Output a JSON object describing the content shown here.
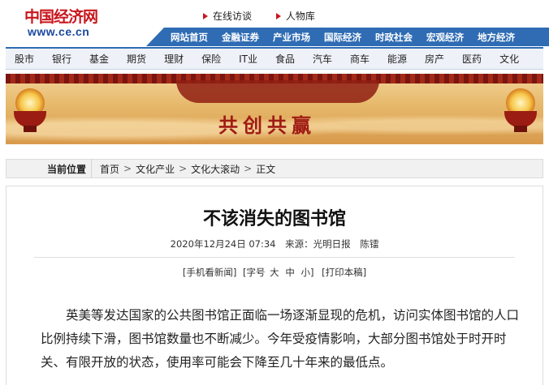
{
  "header": {
    "logo_text": "中国经济网",
    "logo_url": "www.ce.cn",
    "top_links": [
      "在线访谈",
      "人物库"
    ],
    "main_nav": [
      "网站首页",
      "金融证券",
      "产业市场",
      "国际经济",
      "时政社会",
      "宏观经济",
      "地方经济"
    ]
  },
  "categories": [
    "股市",
    "银行",
    "基金",
    "期货",
    "理财",
    "保险",
    "IT业",
    "食品",
    "汽车",
    "商车",
    "能源",
    "房产",
    "医药",
    "文化"
  ],
  "banner": {
    "slogan": "共创共赢"
  },
  "breadcrumb": {
    "label": "当前位置",
    "items": [
      "首页",
      "文化产业",
      "文化大滚动",
      "正文"
    ]
  },
  "article": {
    "title": "不该消失的图书馆",
    "date": "2020年12月24日 07:34",
    "source": "来源：光明日报",
    "author": "陈镭",
    "tools": {
      "mobile": "[手机看新闻]",
      "font_label": "[字号",
      "font_large": "大",
      "font_mid": "中",
      "font_small": "小]",
      "print": "[打印本稿]"
    },
    "paragraph": "英美等发达国家的公共图书馆正面临一场逐渐显现的危机，访问实体图书馆的人口比例持续下滑，图书馆数量也不断减少。今年受疫情影响，大部分图书馆处于时开时关、有限开放的状态，使用率可能会下降至几十年来的最低点。"
  },
  "colors": {
    "brand_red": "#c8161d",
    "nav_blue": "#2f6cb4"
  }
}
